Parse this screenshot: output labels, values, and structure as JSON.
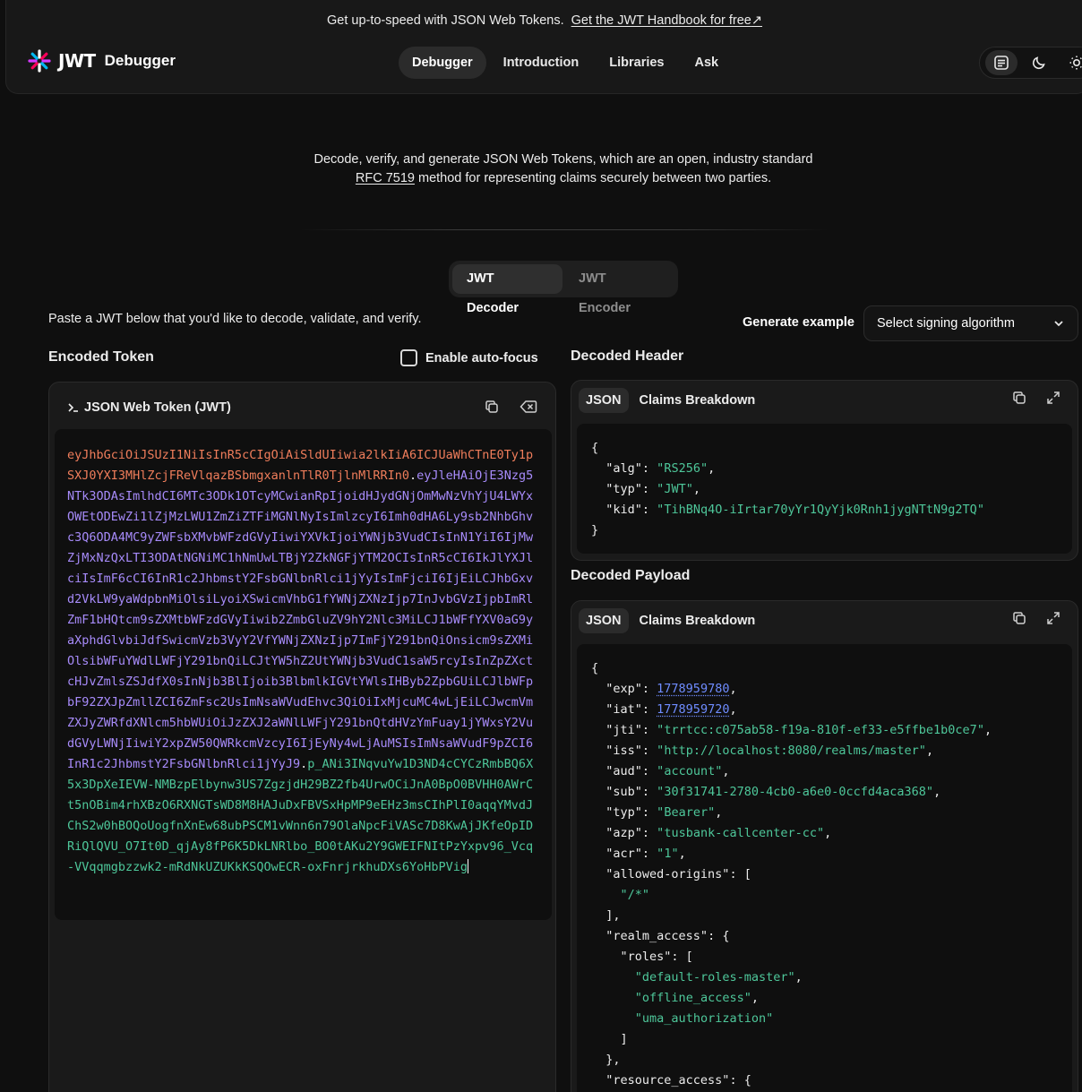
{
  "promo": {
    "text": "Get up-to-speed with JSON Web Tokens.",
    "link": "Get the JWT Handbook for free"
  },
  "header": {
    "logo_word": "JWT",
    "logo_suffix": "Debugger",
    "nav": [
      "Debugger",
      "Introduction",
      "Libraries",
      "Ask"
    ],
    "active_nav": "Debugger"
  },
  "intro": {
    "line1": "Decode, verify, and generate JSON Web Tokens, which are an open, industry standard",
    "rfc_link": "RFC 7519",
    "line2_rest": " method for representing claims securely between two parties."
  },
  "mode_tabs": [
    "JWT Decoder",
    "JWT Encoder"
  ],
  "instructions": "Paste a JWT below that you'd like to decode, validate, and verify.",
  "generate": {
    "label": "Generate example",
    "select_value": "Select signing algorithm"
  },
  "encoded": {
    "title": "Encoded Token",
    "autofocus_label": "Enable auto-focus",
    "autofocus_checked": false,
    "panel_label": "JSON Web Token (JWT)",
    "header_part": "eyJhbGciOiJSUzI1NiIsInR5cCIgOiAiSldUIiwia2lkIiA6ICJUaWhCTnE0Ty1pSXJ0YXI3MHlZcjFReVlqazBSbmgxanlnTlR0TjlnMlRRIn0",
    "payload_part": "eyJleHAiOjE3Nzg5NTk3ODAsImlhdCI6MTc3ODk1OTcyMCwianRpIjoidHJydGNjOmMwNzVhYjU4LWYxOWEtODEwZi1lZjMzLWU1ZmZiZTFiMGNlNyIsImlzcyI6Imh0dHA6Ly9sb2NhbGhvc3Q6ODA4MC9yZWFsbXMvbWFzdGVyIiwiYXVkIjoiYWNjb3VudCIsInN1YiI6IjMwZjMxNzQxLTI3ODAtNGNiMC1hNmUwLTBjY2ZkNGFjYTM2OCIsInR5cCI6IkJlYXJlciIsImF6cCI6InR1c2JhbmstY2FsbGNlbnRlci1jYyIsImFjciI6IjEiLCJhbGxvd2VkLW9yaWdpbnMiOlsiLyoiXSwicmVhbG1fYWNjZXNzIjp7InJvbGVzIjpbImRlZmF1bHQtcm9sZXMtbWFzdGVyIiwib2ZmbGluZV9hY2Nlc3MiLCJ1bWFfYXV0aG9yaXphdGlvbiJdfSwicmVzb3VyY2VfYWNjZXNzIjp7ImFjY291bnQiOnsicm9sZXMiOlsibWFuYWdlLWFjY291bnQiLCJtYW5hZ2UtYWNjb3VudC1saW5rcyIsInZpZXctcHJvZmlsZSJdfX0sInNjb3BlIjoib3BlbmlkIGVtYWlsIHByb2ZpbGUiLCJlbWFpbF92ZXJpZmllZCI6ZmFsc2UsImNsaWVudEhvc3QiOiIxMjcuMC4wLjEiLCJwcmVmZXJyZWRfdXNlcm5hbWUiOiJzZXJ2aWNlLWFjY291bnQtdHVzYmFuay1jYWxsY2VudGVyLWNjIiwiY2xpZW50QWRkcmVzcyI6IjEyNy4wLjAuMSIsImNsaWVudF9pZCI6InR1c2JhbmstY2FsbGNlbnRlci1jYyJ9",
    "signature_part": "p_ANi3INqvuYw1D3ND4cCYCzRmbBQ6X5x3DpXeIEVW-NMBzpElbynw3US7ZgzjdH29BZ2fb4UrwOCiJnA0BpO0BVHH0AWrCt5nOBim4rhXBzO6RXNGTsWD8M8HAJuDxFBVSxHpMP9eEHz3msCIhPlI0aqqYMvdJChS2w0hBOQoUogfnXnEw68ubPSCM1vWnn6n79OlaNpcFiVASc7D8KwAjJKfeOpIDRiQlQVU_O7It0D_qjAy8fP6K5DkLNRlbo_BO0tAKu2Y9GWEIFNItPzYxpv96_Vcq-VVqqmgbzzwk2-mRdNkUZUKkKSQOwECR-oxFnrjrkhuDXs6YoHbPVig"
  },
  "decoded_header": {
    "title": "Decoded Header",
    "tabs": [
      "JSON",
      "Claims Breakdown"
    ],
    "json": {
      "alg": "RS256",
      "typ": "JWT",
      "kid": "TihBNq4O-iIrtar70yYr1QyYjk0Rnh1jygNTtN9g2TQ"
    }
  },
  "decoded_payload": {
    "title": "Decoded Payload",
    "tabs": [
      "JSON",
      "Claims Breakdown"
    ],
    "json": {
      "exp": 1778959780,
      "iat": 1778959720,
      "jti": "trrtcc:c075ab58-f19a-810f-ef33-e5ffbe1b0ce7",
      "iss": "http://localhost:8080/realms/master",
      "aud": "account",
      "sub": "30f31741-2780-4cb0-a6e0-0ccfd4aca368",
      "typ": "Bearer",
      "azp": "tusbank-callcenter-cc",
      "acr": "1",
      "allowed-origins": [
        "/*"
      ],
      "realm_access": {
        "roles": [
          "default-roles-master",
          "offline_access",
          "uma_authorization"
        ]
      },
      "resource_access": {}
    }
  },
  "colors": {
    "header_part": "#ef7d5b",
    "payload_part": "#a78bfa",
    "signature_part": "#4ec79a",
    "number": "#6f8cff",
    "string": "#4ec79a"
  }
}
